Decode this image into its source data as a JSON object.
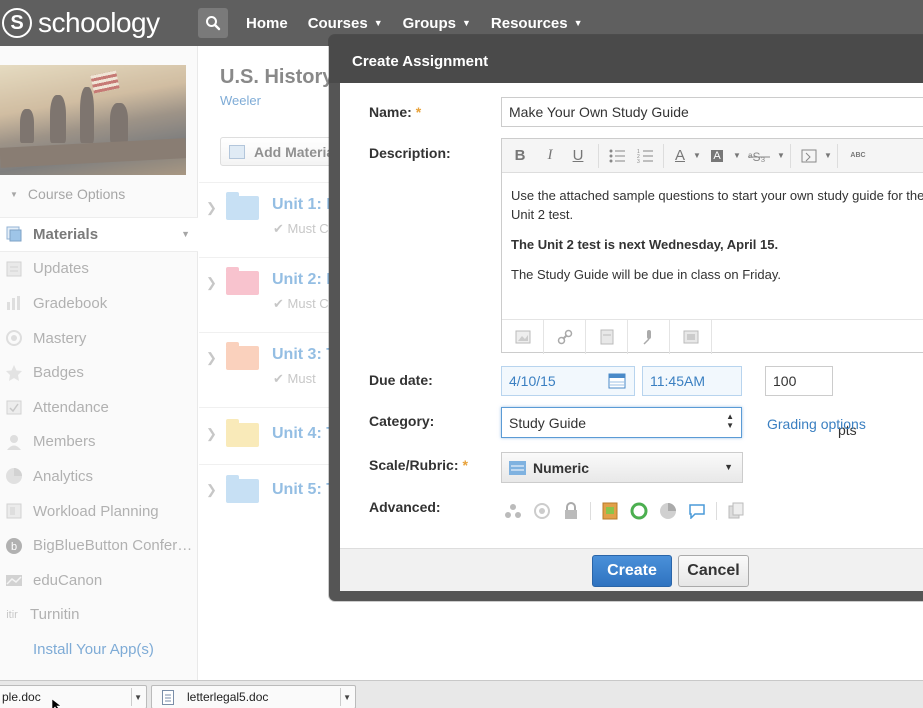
{
  "nav": {
    "logo_letter": "S",
    "logo_text": "schoology",
    "items": [
      {
        "label": "Home",
        "caret": ""
      },
      {
        "label": "Courses",
        "caret": "▼"
      },
      {
        "label": "Groups",
        "caret": "▼"
      },
      {
        "label": "Resources",
        "caret": "▼"
      }
    ]
  },
  "sidebar": {
    "course_options": "Course Options",
    "items": [
      {
        "label": "Materials",
        "icon": "materials-icon",
        "active": true
      },
      {
        "label": "Updates",
        "icon": "updates-icon"
      },
      {
        "label": "Gradebook",
        "icon": "gradebook-icon"
      },
      {
        "label": "Mastery",
        "icon": "mastery-icon"
      },
      {
        "label": "Badges",
        "icon": "badges-icon"
      },
      {
        "label": "Attendance",
        "icon": "attendance-icon"
      },
      {
        "label": "Members",
        "icon": "members-icon"
      },
      {
        "label": "Analytics",
        "icon": "analytics-icon"
      },
      {
        "label": "Workload Planning",
        "icon": "workload-icon"
      },
      {
        "label": "BigBlueButton Confer…",
        "icon": "bigbluebutton-icon"
      },
      {
        "label": "eduCanon",
        "icon": "educanon-icon"
      },
      {
        "label": "Turnitin",
        "icon": "turnitin-icon",
        "icon_text": "itir"
      },
      {
        "label": "Install Your App(s)",
        "icon": ""
      }
    ]
  },
  "main": {
    "course_title": "U.S. History",
    "course_sub": "Weeler",
    "add_materials": "Add Materia",
    "units": [
      {
        "name": "Unit 1: N",
        "sub": "Must C",
        "color": "#a9cfee"
      },
      {
        "name": "Unit 2: L",
        "sub": "Must C",
        "color": "#f5a3b4"
      },
      {
        "name": "Unit 3: T",
        "sub": "Must",
        "color": "#f7b89a"
      },
      {
        "name": "Unit 4: T",
        "sub": "",
        "color": "#f6df94"
      },
      {
        "name": "Unit 5: T",
        "sub": "",
        "color": "#a9cfee"
      }
    ]
  },
  "modal": {
    "title": "Create Assignment",
    "name_label": "Name:",
    "required_mark": "*",
    "name_value": "Make Your Own Study Guide",
    "description_label": "Description:",
    "toolbar": {
      "bold": "B",
      "italic": "I",
      "underline": "U",
      "font_color": "A",
      "highlight": "A",
      "spellcheck": "ABC"
    },
    "description": {
      "p1": "Use the attached sample questions to start your own study guide for the Unit 2 test.",
      "p2": "The Unit 2 test is next Wednesday, April 15.",
      "p3": "The Study Guide will be due in class on Friday."
    },
    "due_label": "Due date:",
    "due_date": "4/10/15",
    "due_time": "11:45AM",
    "points": "100",
    "pts_label": "pts",
    "category_label": "Category:",
    "category_value": "Study Guide",
    "grading_options": "Grading options",
    "scale_label": "Scale/Rubric:",
    "scale_value": "Numeric",
    "advanced_label": "Advanced:",
    "create_label": "Create",
    "cancel_label": "Cancel"
  },
  "downloads": [
    {
      "name": "ple.doc"
    },
    {
      "name": "letterlegal5.doc"
    }
  ],
  "colors": {
    "nav_bg": "#5f5f5f",
    "link": "#3a7fc1",
    "primary_button": "#2f73c0",
    "required": "#e8a23a"
  }
}
